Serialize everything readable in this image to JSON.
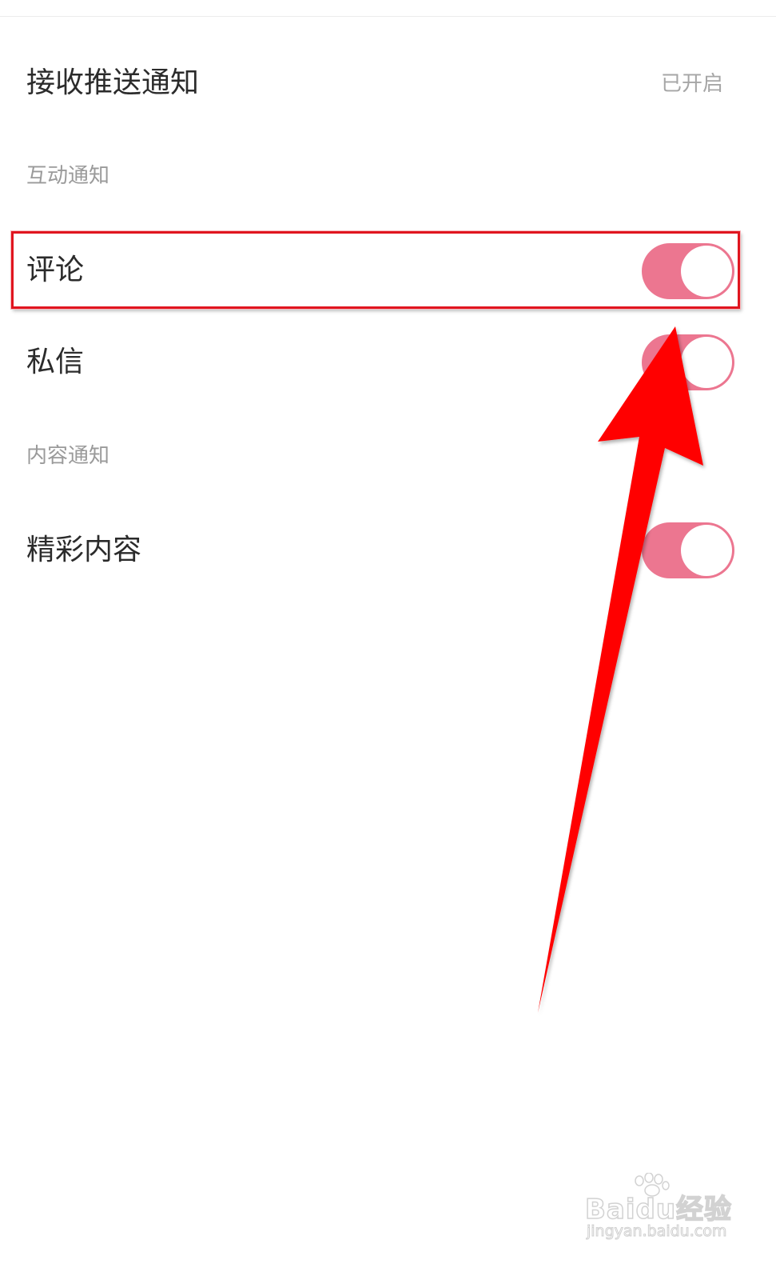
{
  "push": {
    "title": "接收推送通知",
    "status": "已开启"
  },
  "sections": {
    "interaction": "互动通知",
    "content": "内容通知"
  },
  "items": {
    "comments": {
      "label": "评论",
      "enabled": true
    },
    "messages": {
      "label": "私信",
      "enabled": true
    },
    "highlights": {
      "label": "精彩内容",
      "enabled": true
    }
  },
  "colors": {
    "toggle_on": "#ec7690",
    "annotation": "#ff0000"
  },
  "watermark": {
    "brand": "Baidu经验",
    "url": "jingyan.baidu.com"
  }
}
